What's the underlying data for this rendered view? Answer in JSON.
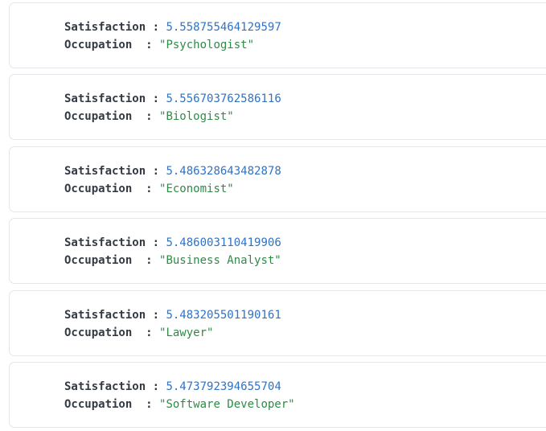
{
  "colors": {
    "key": "#333a44",
    "number": "#2f72c6",
    "string": "#2f8a48",
    "card_border": "#e4e6ea"
  },
  "records": [
    {
      "satisfaction_key": "Satisfaction",
      "satisfaction": "5.558755464129597",
      "occupation_key": "Occupation",
      "occupation": "\"Psychologist\""
    },
    {
      "satisfaction_key": "Satisfaction",
      "satisfaction": "5.556703762586116",
      "occupation_key": "Occupation",
      "occupation": "\"Biologist\""
    },
    {
      "satisfaction_key": "Satisfaction",
      "satisfaction": "5.486328643482878",
      "occupation_key": "Occupation",
      "occupation": "\"Economist\""
    },
    {
      "satisfaction_key": "Satisfaction",
      "satisfaction": "5.486003110419906",
      "occupation_key": "Occupation",
      "occupation": "\"Business Analyst\""
    },
    {
      "satisfaction_key": "Satisfaction",
      "satisfaction": "5.483205501190161",
      "occupation_key": "Occupation",
      "occupation": "\"Lawyer\""
    },
    {
      "satisfaction_key": "Satisfaction",
      "satisfaction": "5.473792394655704",
      "occupation_key": "Occupation",
      "occupation": "\"Software Developer\""
    }
  ]
}
